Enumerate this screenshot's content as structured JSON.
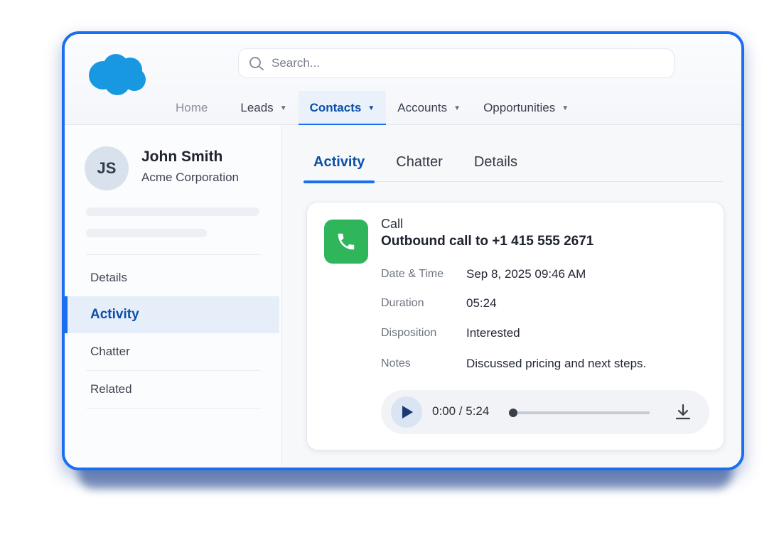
{
  "header": {
    "search": {
      "placeholder": "Search..."
    },
    "nav": [
      {
        "label": "Home"
      },
      {
        "label": "Leads"
      },
      {
        "label": "Contacts"
      },
      {
        "label": "Accounts"
      },
      {
        "label": "Opportunities"
      }
    ],
    "active_nav": "Contacts"
  },
  "contact": {
    "initials": "JS",
    "name": "John Smith",
    "company": "Acme Corporation"
  },
  "sidebar": {
    "items": [
      {
        "label": "Details"
      },
      {
        "label": "Activity"
      },
      {
        "label": "Chatter"
      },
      {
        "label": "Related"
      }
    ],
    "active": "Activity"
  },
  "main": {
    "tabs": [
      {
        "label": "Activity"
      },
      {
        "label": "Chatter"
      },
      {
        "label": "Details"
      }
    ],
    "active_tab": "Activity"
  },
  "activity": {
    "type": "Call",
    "title": "Outbound call to +1 415 555 2671",
    "fields": [
      {
        "label": "Date & Time",
        "value": "Sep 8, 2025  09:46 AM"
      },
      {
        "label": "Duration",
        "value": "05:24"
      },
      {
        "label": "Disposition",
        "value": "Interested"
      },
      {
        "label": "Notes",
        "value": "Discussed pricing and next steps."
      }
    ],
    "player": {
      "time": "0:00 / 5:24",
      "progress": 0
    }
  },
  "colors": {
    "brand_blue": "#1a6ff0",
    "logo_blue": "#1798e0",
    "call_green": "#2fb65a",
    "active_text": "#0b4fa8"
  },
  "icons": {
    "logo": "cloud-logo-icon",
    "search": "search-icon",
    "caret": "chevron-down-icon",
    "call": "phone-icon",
    "play": "play-icon",
    "download": "download-icon"
  }
}
